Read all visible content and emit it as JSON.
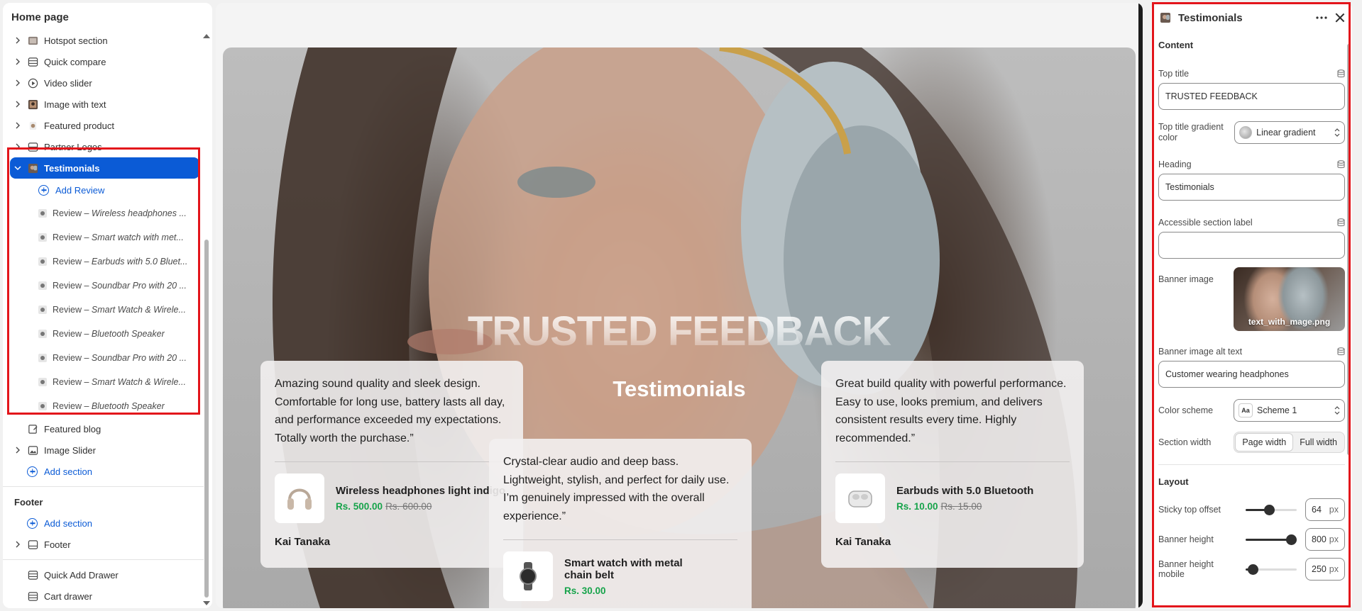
{
  "sidebar": {
    "title": "Home page",
    "sections": [
      {
        "label": "Hotspot section"
      },
      {
        "label": "Quick compare"
      },
      {
        "label": "Video slider"
      },
      {
        "label": "Image with text"
      },
      {
        "label": "Featured product"
      },
      {
        "label": "Partner Logos"
      }
    ],
    "active": {
      "label": "Testimonials"
    },
    "add_review": "Add Review",
    "reviews": [
      {
        "prefix": "Review – ",
        "name": "Wireless headphones ..."
      },
      {
        "prefix": "Review – ",
        "name": "Smart watch with met..."
      },
      {
        "prefix": "Review – ",
        "name": "Earbuds with 5.0 Bluet..."
      },
      {
        "prefix": "Review – ",
        "name": "Soundbar Pro with 20 ..."
      },
      {
        "prefix": "Review – ",
        "name": "Smart Watch & Wirele..."
      },
      {
        "prefix": "Review – ",
        "name": "Bluetooth Speaker"
      },
      {
        "prefix": "Review – ",
        "name": "Soundbar Pro with 20 ..."
      },
      {
        "prefix": "Review – ",
        "name": "Smart Watch & Wirele..."
      },
      {
        "prefix": "Review – ",
        "name": "Bluetooth Speaker"
      }
    ],
    "after": [
      {
        "label": "Featured blog"
      },
      {
        "label": "Image Slider"
      }
    ],
    "add_section": "Add section",
    "footer_group": "Footer",
    "footer_add_section": "Add section",
    "footer_item": "Footer",
    "quick_add_drawer": "Quick Add Drawer",
    "cart_drawer": "Cart drawer"
  },
  "preview": {
    "top_title": "TRUSTED FEEDBACK",
    "heading": "Testimonials",
    "cards": [
      {
        "quote": "Amazing sound quality and sleek design. Comfortable for long use, battery lasts all day, and performance exceeded my expectations. Totally worth the purchase.”",
        "product": "Wireless headphones light indigo",
        "price": "Rs. 500.00",
        "compare": "Rs. 600.00",
        "author": "Kai Tanaka"
      },
      {
        "quote": "Crystal-clear audio and deep bass. Lightweight, stylish, and perfect for daily use. I’m genuinely impressed with the overall experience.”",
        "product": "Smart watch with metal chain belt",
        "price": "Rs. 30.00"
      },
      {
        "quote": "Great build quality with powerful performance. Easy to use, looks premium, and delivers consistent results every time. Highly recommended.”",
        "product": "Earbuds with 5.0 Bluetooth",
        "price": "Rs. 10.00",
        "compare": "Rs. 15.00",
        "author": "Kai Tanaka"
      }
    ]
  },
  "panel": {
    "title": "Testimonials",
    "content_heading": "Content",
    "top_title_label": "Top title",
    "top_title_value": "TRUSTED FEEDBACK",
    "gradient_label": "Top title gradient color",
    "gradient_value": "Linear gradient",
    "heading_label": "Heading",
    "heading_value": "Testimonials",
    "accessible_label": "Accessible section label",
    "accessible_value": "",
    "banner_image_label": "Banner image",
    "banner_image_file": "text_with_mage.png",
    "alt_label": "Banner image alt text",
    "alt_value": "Customer wearing headphones",
    "color_scheme_label": "Color scheme",
    "color_scheme_value": "Scheme 1",
    "color_scheme_icon": "Aa",
    "section_width_label": "Section width",
    "section_width_options": [
      "Page width",
      "Full width"
    ],
    "section_width_selected": "Page width",
    "layout_heading": "Layout",
    "sticky_label": "Sticky top offset",
    "sticky_value": "64",
    "sticky_level": 0.45,
    "banner_height_label": "Banner height",
    "banner_height_value": "800",
    "banner_height_level": 1.0,
    "banner_height_mobile_label": "Banner height mobile",
    "banner_height_mobile_value": "250",
    "banner_height_mobile_level": 0.05,
    "unit": "px"
  },
  "colors": {
    "accent": "#0b5bd6",
    "highlight": "#e3151b",
    "price": "#16a34a"
  }
}
